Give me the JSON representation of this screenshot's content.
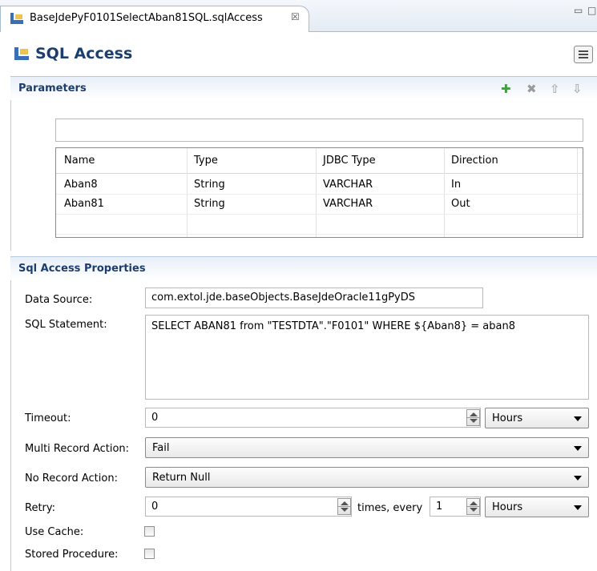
{
  "tab": {
    "title": "BaseJdePyF0101SelectAban81SQL.sqlAccess",
    "close_glyph": "☒"
  },
  "window_controls": {
    "minimize": "▭",
    "maximize": "□"
  },
  "form": {
    "title": "SQL Access"
  },
  "parameters": {
    "title": "Parameters",
    "filter_value": "",
    "columns": [
      "Name",
      "Type",
      "JDBC Type",
      "Direction"
    ],
    "rows": [
      [
        "Aban8",
        "String",
        "VARCHAR",
        "In"
      ],
      [
        "Aban81",
        "String",
        "VARCHAR",
        "Out"
      ]
    ],
    "toolbar": {
      "add": "✚",
      "remove": "✖",
      "up": "⇧",
      "down": "⇩"
    }
  },
  "properties": {
    "title": "Sql Access Properties",
    "data_source_label": "Data Source:",
    "data_source_value": "com.extol.jde.baseObjects.BaseJdeOracle11gPyDS",
    "sql_label": "SQL Statement:",
    "sql_value": "SELECT ABAN81 from \"TESTDTA\".\"F0101\" WHERE ${Aban8} = aban8",
    "timeout_label": "Timeout:",
    "timeout_value": "0",
    "timeout_unit": "Hours",
    "multi_label": "Multi Record Action:",
    "multi_value": "Fail",
    "norecord_label": "No Record Action:",
    "norecord_value": "Return Null",
    "retry_label": "Retry:",
    "retry_value": "0",
    "retry_times_label": "times, every",
    "retry_interval": "1",
    "retry_unit": "Hours",
    "cache_label": "Use Cache:",
    "cache_checked": false,
    "stored_label": "Stored Procedure:",
    "stored_checked": false
  },
  "colors": {
    "title_blue": "#1c3e6e",
    "section_border": "#b7c9e0",
    "add_green": "#3aa33a"
  }
}
